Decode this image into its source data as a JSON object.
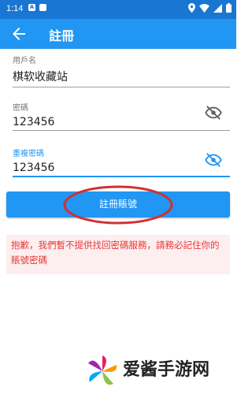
{
  "status_bar": {
    "time": "1:14",
    "notif_letter": "A"
  },
  "app_bar": {
    "title": "註冊"
  },
  "form": {
    "username": {
      "label": "用戶名",
      "value": "棋软收藏站"
    },
    "password": {
      "label": "密碼",
      "value": "123456"
    },
    "confirm_password": {
      "label": "重複密碼",
      "value": "123456"
    }
  },
  "actions": {
    "register_label": "註冊賬號"
  },
  "notice": {
    "text": "抱歉，我們暫不提供找回密碼服務，請務必記住你的賬號密碼"
  },
  "watermark": {
    "text": "爱酱手游网"
  },
  "colors": {
    "primary": "#2196f3",
    "status": "#1976d2",
    "accent_ellipse": "#d32f2f",
    "notice_text": "#e53935"
  }
}
